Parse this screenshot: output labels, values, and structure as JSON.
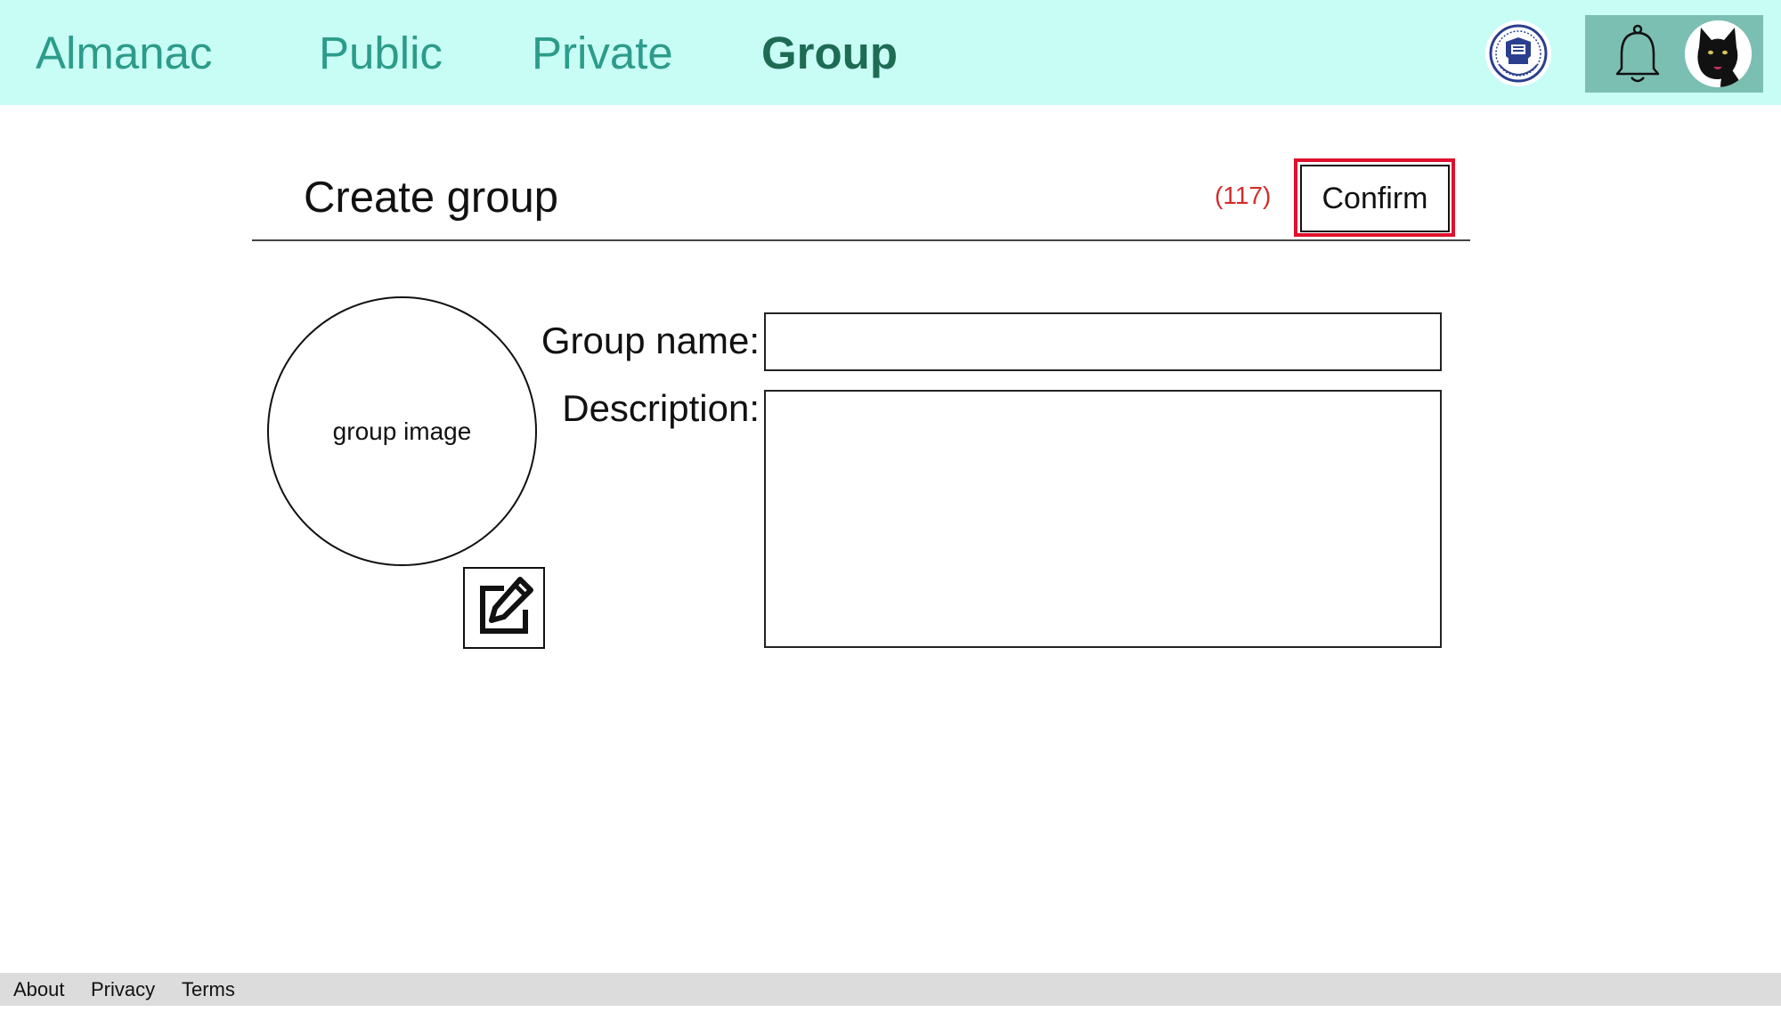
{
  "nav": {
    "items": [
      {
        "label": "Almanac",
        "active": false
      },
      {
        "label": "Public",
        "active": false
      },
      {
        "label": "Private",
        "active": false
      },
      {
        "label": "Group",
        "active": true
      }
    ],
    "logo_icon": "university-seal-icon",
    "notification_icon": "bell-icon",
    "avatar_icon": "black-cat-avatar"
  },
  "page": {
    "title": "Create group",
    "counter": "(117)",
    "confirm_label": "Confirm"
  },
  "form": {
    "image_placeholder": "group image",
    "edit_image_icon": "edit-pencil-icon",
    "name_label": "Group name:",
    "name_value": "",
    "description_label": "Description:",
    "description_value": ""
  },
  "footer": {
    "links": [
      "About",
      "Privacy",
      "Terms"
    ]
  },
  "colors": {
    "topbar_bg": "#c8fdf6",
    "nav_text": "#2c9c8a",
    "nav_active": "#1e6b53",
    "user_panel_bg": "#7bbfb2",
    "counter_text": "#d42a2a",
    "confirm_highlight": "#e0102c",
    "footer_bg": "#dcdcdc"
  }
}
